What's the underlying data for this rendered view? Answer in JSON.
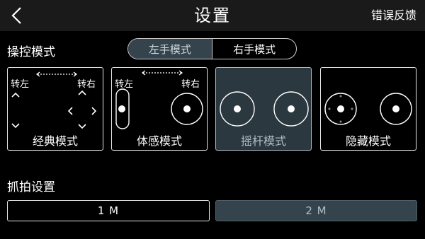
{
  "header": {
    "title": "设置",
    "feedback_label": "错误反馈"
  },
  "control_mode": {
    "section_label": "操控模式",
    "hand_options": [
      {
        "label": "左手模式",
        "active": true
      },
      {
        "label": "右手模式",
        "active": false
      }
    ],
    "cards": [
      {
        "label": "经典模式",
        "left_label": "转左",
        "right_label": "转右",
        "selected": false
      },
      {
        "label": "体感模式",
        "left_label": "转左",
        "right_label": "转右",
        "selected": false
      },
      {
        "label": "摇杆模式",
        "selected": true
      },
      {
        "label": "隐藏模式",
        "selected": false
      }
    ]
  },
  "capture": {
    "section_label": "抓拍设置",
    "options": [
      {
        "label": "1 M",
        "selected": false
      },
      {
        "label": "2 M",
        "selected": true
      }
    ]
  }
}
